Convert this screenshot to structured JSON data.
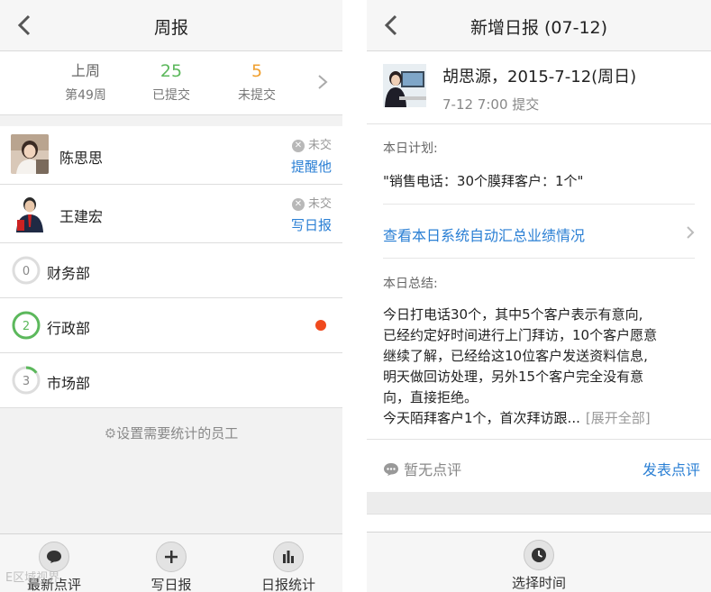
{
  "left": {
    "nav": {
      "title": "周报"
    },
    "summary": {
      "week_label": "上周",
      "week_number": "第49周",
      "submitted_count": "25",
      "submitted_label": "已提交",
      "unsubmitted_count": "5",
      "unsubmitted_label": "未提交"
    },
    "employees": [
      {
        "name": "陈思思",
        "status": "未交",
        "action": "提醒他"
      },
      {
        "name": "王建宏",
        "status": "未交",
        "action": "写日报"
      }
    ],
    "departments": [
      {
        "count": "0",
        "name": "财务部",
        "progress": 0,
        "has_alert": false
      },
      {
        "count": "2",
        "name": "行政部",
        "progress": 1,
        "has_alert": true
      },
      {
        "count": "3",
        "name": "市场部",
        "progress": 0.15,
        "has_alert": false
      }
    ],
    "settings_link": "设置需要统计的员工",
    "tabs": [
      {
        "label": "最新点评",
        "icon": "chat-bubble-icon"
      },
      {
        "label": "写日报",
        "icon": "plus-icon"
      },
      {
        "label": "日报统计",
        "icon": "bar-chart-icon"
      }
    ],
    "watermark": "E区域视界"
  },
  "right": {
    "nav": {
      "title": "新增日报 (07-12)"
    },
    "report": {
      "title": "胡思源，2015-7-12(周日)",
      "submit_time": "7-12 7:00 提交"
    },
    "plan_label": "本日计划:",
    "plan_text": "\"销售电话：30个膜拜客户：1个\"",
    "auto_summary_link": "查看本日系统自动汇总业绩情况",
    "summary_label": "本日总结:",
    "summary_lines": [
      "今日打电话30个，其中5个客户表示有意向,",
      "已经约定好时间进行上门拜访，10个客户愿意",
      "继续了解，已经给这10位客户发送资料信息,",
      "明天做回访处理，另外15个客户完全没有意",
      "向，直接拒绝。"
    ],
    "summary_last_line": "今天陌拜客户1个，首次拜访跟...",
    "expand_label": "[展开全部]",
    "no_comment": "暂无点评",
    "post_comment": "发表点评",
    "tab": {
      "label": "选择时间",
      "icon": "clock-icon"
    }
  },
  "colors": {
    "accent": "#2a7fd4",
    "green": "#5cb85c",
    "orange": "#f0a030",
    "red": "#f04a1e"
  }
}
